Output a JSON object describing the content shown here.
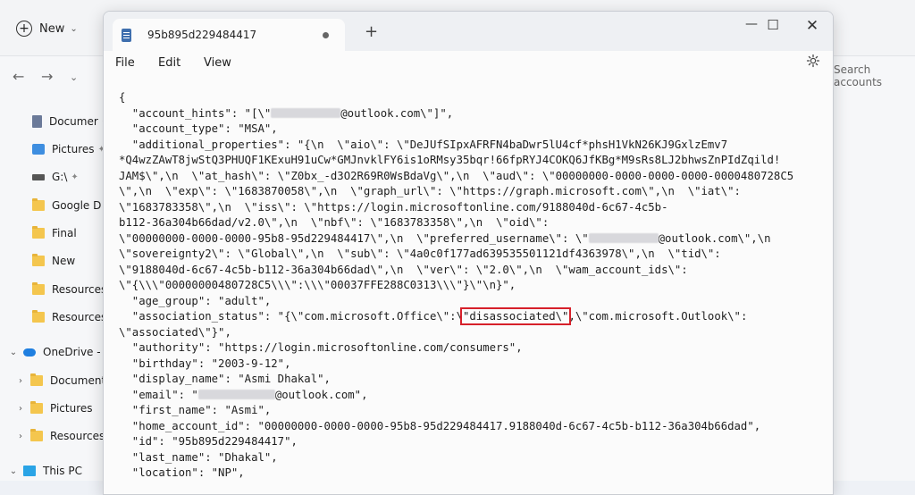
{
  "explorer": {
    "new_label": "New",
    "search_placeholder": "Search accounts",
    "sidebar": [
      {
        "label": "Documer",
        "icon": "document-icon",
        "pinned": true
      },
      {
        "label": "Pictures",
        "icon": "pictures-icon",
        "pinned": true
      },
      {
        "label": "G:\\",
        "icon": "drive-icon",
        "pinned": true
      },
      {
        "label": "Google D",
        "icon": "folder-icon",
        "pinned": true
      },
      {
        "label": "Final",
        "icon": "folder-icon"
      },
      {
        "label": "New",
        "icon": "folder-icon"
      },
      {
        "label": "Resources",
        "icon": "folder-icon"
      },
      {
        "label": "Resources",
        "icon": "folder-icon"
      },
      {
        "label": "OneDrive - P",
        "icon": "onedrive-icon",
        "expand": "open"
      },
      {
        "label": "Documents",
        "icon": "folder-icon",
        "expand": "closed"
      },
      {
        "label": "Pictures",
        "icon": "folder-icon",
        "expand": "closed"
      },
      {
        "label": "Resources",
        "icon": "folder-icon",
        "expand": "closed"
      },
      {
        "label": "This PC",
        "icon": "this-pc-icon",
        "expand": "open"
      }
    ]
  },
  "notepad": {
    "tab_title": "95b895d229484417",
    "menu": [
      "File",
      "Edit",
      "View"
    ],
    "lines": [
      {
        "t": "{"
      },
      {
        "t": "  \"account_hints\": \"[\\\"",
        "r": true,
        "a": "@outlook.com\\\"]\","
      },
      {
        "t": "  \"account_type\": \"MSA\","
      },
      {
        "t": "  \"additional_properties\": \"{\\n  \\\"aio\\\": \\\"DeJUfSIpxAFRFN4baDwr5lU4cf*phsH1VkN26KJ9GxlzEmv7"
      },
      {
        "t": "*Q4wzZAwT8jwStQ3PHUQF1KExuH91uCw*GMJnvklFY6is1oRMsy35bqr!66fpRYJ4COKQ6JfKBg*M9sRs8LJ2bhwsZnPIdZqild!"
      },
      {
        "t": "JAM$\\\",\\n  \\\"at_hash\\\": \\\"Z0bx_-d3O2R69R0WsBdaVg\\\",\\n  \\\"aud\\\": \\\"00000000-0000-0000-0000-0000480728C5"
      },
      {
        "t": "\\\",\\n  \\\"exp\\\": \\\"1683870058\\\",\\n  \\\"graph_url\\\": \\\"https://graph.microsoft.com\\\",\\n  \\\"iat\\\":"
      },
      {
        "t": "\\\"1683783358\\\",\\n  \\\"iss\\\": \\\"https://login.microsoftonline.com/9188040d-6c67-4c5b-"
      },
      {
        "t": "b112-36a304b66dad/v2.0\\\",\\n  \\\"nbf\\\": \\\"1683783358\\\",\\n  \\\"oid\\\":"
      },
      {
        "t": "\\\"00000000-0000-0000-95b8-95d229484417\\\",\\n  \\\"preferred_username\\\": \\\"",
        "r": true,
        "a": "@outlook.com\\\",\\n"
      },
      {
        "t": "\\\"sovereignty2\\\": \\\"Global\\\",\\n  \\\"sub\\\": \\\"4a0c0f177ad639535501121df4363978\\\",\\n  \\\"tid\\\":"
      },
      {
        "t": "\\\"9188040d-6c67-4c5b-b112-36a304b66dad\\\",\\n  \\\"ver\\\": \\\"2.0\\\",\\n  \\\"wam_account_ids\\\":"
      },
      {
        "t": "\\\"{\\\\\\\"00000000480728C5\\\\\\\":\\\\\\\"00037FFE288C0313\\\\\\\"}\\\"\\n}\","
      },
      {
        "t": "  \"age_group\": \"adult\","
      },
      {
        "t": "  \"association_status\": \"{\\\"com.microsoft.Office\\\":\\",
        "h": "\"disassociated\\\"",
        "a": ",\\\"com.microsoft.Outlook\\\":"
      },
      {
        "t": "\\\"associated\\\"}\","
      },
      {
        "t": "  \"authority\": \"https://login.microsoftonline.com/consumers\","
      },
      {
        "t": "  \"birthday\": \"2003-9-12\","
      },
      {
        "t": "  \"display_name\": \"Asmi Dhakal\","
      },
      {
        "t": "  \"email\": \"",
        "r": true,
        "a": "@outlook.com\","
      },
      {
        "t": "  \"first_name\": \"Asmi\","
      },
      {
        "t": "  \"home_account_id\": \"00000000-0000-0000-95b8-95d229484417.9188040d-6c67-4c5b-b112-36a304b66dad\","
      },
      {
        "t": "  \"id\": \"95b895d229484417\","
      },
      {
        "t": "  \"last_name\": \"Dhakal\","
      },
      {
        "t": "  \"location\": \"NP\","
      }
    ]
  },
  "colors": {
    "highlight": "#d6202a",
    "folder": "#f4c64e"
  }
}
